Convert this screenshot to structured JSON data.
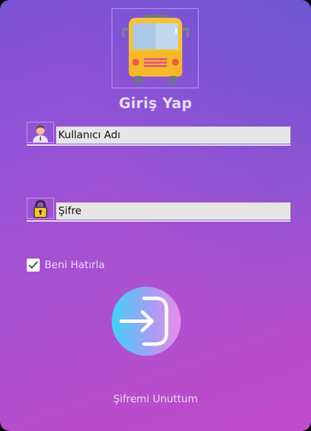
{
  "title": "Giriş Yap",
  "username": {
    "value": "Kullanıcı Adı",
    "icon": "user-avatar-icon"
  },
  "password": {
    "value": "Şifre",
    "icon": "padlock-icon"
  },
  "remember": {
    "label": "Beni Hatırla",
    "checked": true
  },
  "login_button": {
    "icon": "login-arrow-icon"
  },
  "forgot_link": "Şifremi Unuttum",
  "logo": {
    "icon": "bus-icon"
  },
  "colors": {
    "accent_start": "#3fd2f7",
    "accent_end": "#e88be8",
    "background_start": "#7d52d6",
    "background_end": "#c24ac9"
  }
}
